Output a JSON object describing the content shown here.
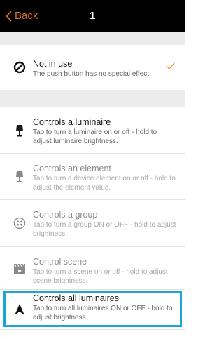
{
  "header": {
    "back_label": "Back",
    "title": "1"
  },
  "items": [
    {
      "label": "Not in use",
      "desc": "The push button has no special effect.",
      "icon": "prohibited-icon",
      "checked": true,
      "disabled": false
    },
    {
      "label": "Controls a luminaire",
      "desc": "Tap to turn a luminaire on or off - hold to adjust luminaire brightness.",
      "icon": "lamp-icon",
      "disabled": false
    },
    {
      "label": "Controls an element",
      "desc": "Tap to turn a device element on or off - hold to adjust the element value.",
      "icon": "lamp-icon",
      "disabled": true
    },
    {
      "label": "Controls a group",
      "desc": "Tap to turn a group ON or OFF - hold to adjust brightness.",
      "icon": "group-icon",
      "disabled": true
    },
    {
      "label": "Control scene",
      "desc": "Tap to turn a scene on or off - hold to adjust scene brightness.",
      "icon": "scene-icon",
      "disabled": true
    },
    {
      "label": "Controls all luminaires",
      "desc": "Tap to turn all luminaires ON or OFF - hold to adjust brightness.",
      "icon": "all-luminaires-icon",
      "disabled": false,
      "highlighted": true
    }
  ],
  "colors": {
    "accent": "#e0701a",
    "highlight": "#1aa7d8",
    "checkmark": "#f0a040"
  }
}
